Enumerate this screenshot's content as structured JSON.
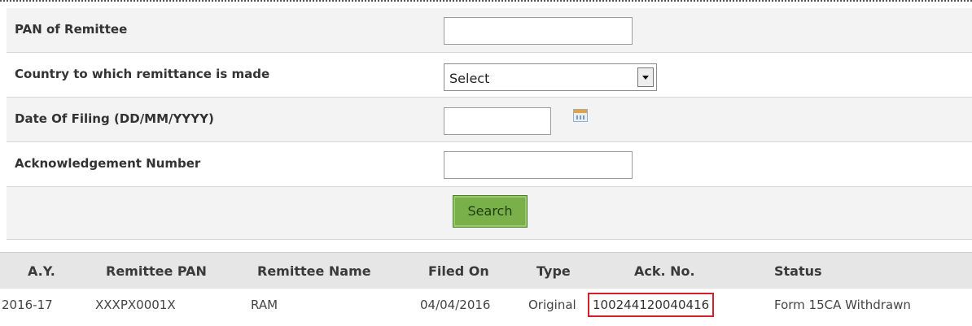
{
  "form": {
    "pan_label": "PAN of Remittee",
    "pan_value": "",
    "country_label": "Country to which remittance is made",
    "country_selected": "Select",
    "date_label": "Date Of Filing (DD/MM/YYYY)",
    "date_value": "",
    "ack_label": "Acknowledgement Number",
    "ack_value": "",
    "search_label": "Search"
  },
  "results": {
    "headers": {
      "ay": "A.Y.",
      "pan": "Remittee PAN",
      "name": "Remittee Name",
      "filed_on": "Filed On",
      "type": "Type",
      "ack_no": "Ack. No.",
      "status": "Status"
    },
    "rows": [
      {
        "ay": "2016-17",
        "pan": "XXXPX0001X",
        "name": "RAM",
        "filed_on": "04/04/2016",
        "type": "Original",
        "ack_no": "100244120040416",
        "status": "Form 15CA Withdrawn"
      }
    ]
  },
  "colors": {
    "highlight": "#d4202b",
    "button": "#79b04a"
  }
}
